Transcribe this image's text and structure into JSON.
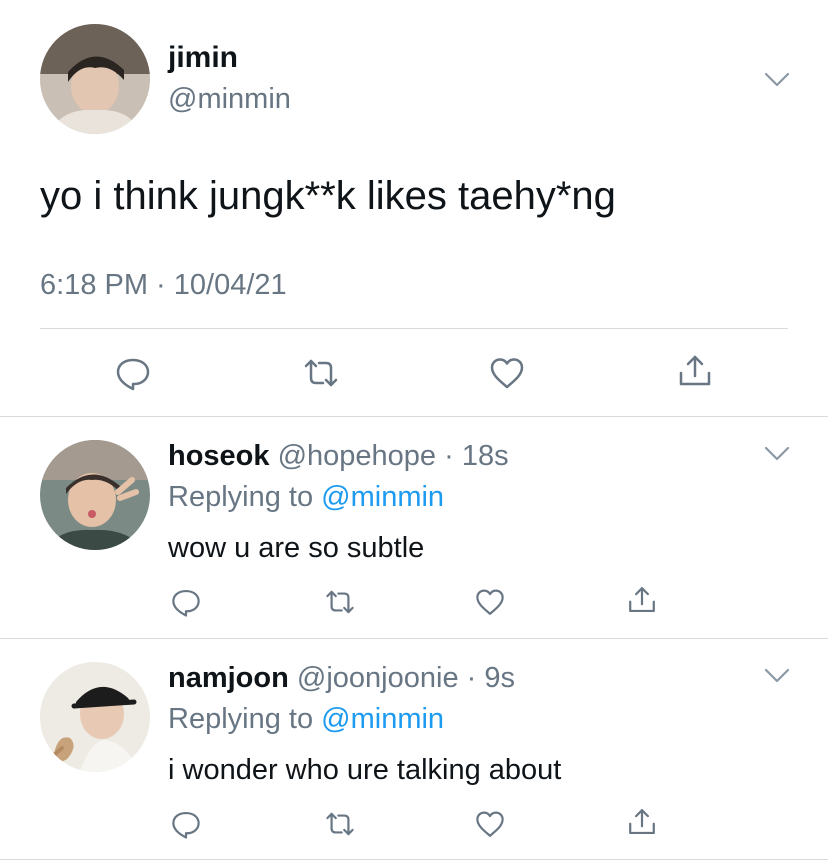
{
  "main_tweet": {
    "author_name": "jimin",
    "author_handle": "@minmin",
    "text": "yo i think jungk**k likes taehy*ng",
    "timestamp": "6:18 PM · 10/04/21",
    "avatar_icon": "avatar-jimin-icon",
    "actions": [
      "reply-icon",
      "retweet-icon",
      "like-icon",
      "share-icon"
    ]
  },
  "replies": [
    {
      "author_name": "hoseok",
      "author_handle": "@hopehope",
      "separator": " · ",
      "time": "18s",
      "replying_prefix": "Replying to ",
      "replying_handle": "@minmin",
      "text": "wow u are so subtle",
      "avatar_icon": "avatar-hoseok-icon"
    },
    {
      "author_name": "namjoon",
      "author_handle": "@joonjoonie",
      "separator": " · ",
      "time": "9s",
      "replying_prefix": "Replying to ",
      "replying_handle": "@minmin",
      "text": "i wonder who ure talking about",
      "avatar_icon": "avatar-namjoon-icon"
    }
  ],
  "colors": {
    "link_blue": "#1d9bf0",
    "secondary_gray": "#687684",
    "text_dark": "#0f1419"
  }
}
